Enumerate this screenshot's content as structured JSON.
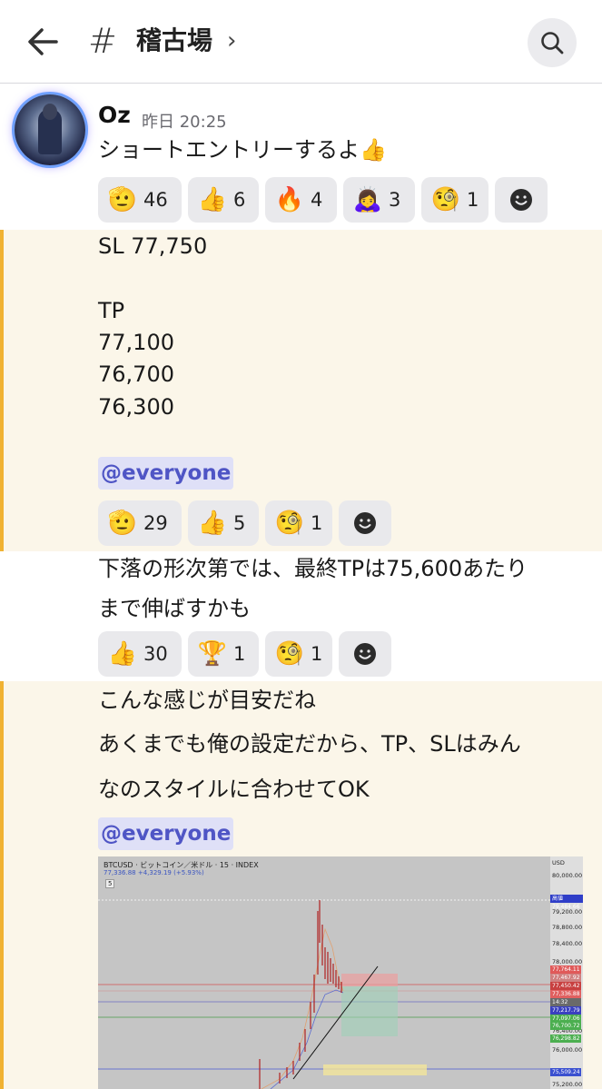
{
  "header": {
    "hash_symbol": "#",
    "channel_name": "稽古場",
    "chevron": "›"
  },
  "message": {
    "username": "Oz",
    "timestamp": "昨日 20:25",
    "first_line": "ショートエントリーするよ👍"
  },
  "reactions_1": [
    {
      "emoji": "🫡",
      "count": "46"
    },
    {
      "emoji": "👍",
      "count": "6"
    },
    {
      "emoji": "🔥",
      "count": "4"
    },
    {
      "emoji": "🙇‍♀️",
      "count": "3"
    },
    {
      "emoji": "🧐",
      "count": "1"
    }
  ],
  "block_2": {
    "sl": "SL 77,750",
    "tp_label": "TP",
    "tp1": "77,100",
    "tp2": "76,700",
    "tp3": "76,300",
    "mention": "@everyone"
  },
  "reactions_2": [
    {
      "emoji": "🫡",
      "count": "29"
    },
    {
      "emoji": "👍",
      "count": "5"
    },
    {
      "emoji": "🧐",
      "count": "1"
    }
  ],
  "block_3": {
    "line1": "下落の形次第では、最終TPは75,600あたり",
    "line2": "まで伸ばすかも"
  },
  "reactions_3": [
    {
      "emoji": "👍",
      "count": "30"
    },
    {
      "emoji": "🏆",
      "count": "1"
    },
    {
      "emoji": "🧐",
      "count": "1"
    }
  ],
  "block_4": {
    "line1": "こんな感じが目安だね",
    "line2": "あくまでも俺の設定だから、TP、SLはみん",
    "line3": "なのスタイルに合わせてOK",
    "mention": "@everyone"
  },
  "chart_image": {
    "symbol_line": "BTCUSD · ビットコイン／米ドル · 15 · INDEX",
    "price_line": "77,336.88  +4,329.19 (+5.93%)",
    "count_badge": "5",
    "currency": "USD",
    "y_ticks": [
      "80,000.00",
      "79,600.00",
      "79,200.00",
      "78,800.00",
      "78,400.00",
      "78,000.00",
      "76,400.00",
      "76,000.00",
      "75,600.00",
      "75,200.00"
    ],
    "tag_high_label": "高値",
    "tag_high": "79,484.66",
    "tags": [
      {
        "v": "77,764.11",
        "c": "#e05a5a"
      },
      {
        "v": "77,467.92",
        "c": "#d08080"
      },
      {
        "v": "77,450.42",
        "c": "#c84040"
      },
      {
        "v": "77,336.88",
        "c": "#e06060"
      },
      {
        "v": "14:32",
        "c": "#6a6a6a"
      },
      {
        "v": "77,217.79",
        "c": "#3a40c0"
      },
      {
        "v": "77,097.06",
        "c": "#4caf50"
      },
      {
        "v": "76,700.72",
        "c": "#4caf50"
      },
      {
        "v": "76,298.82",
        "c": "#4caf50"
      },
      {
        "v": "75,509.24",
        "c": "#3a50d0"
      }
    ]
  }
}
